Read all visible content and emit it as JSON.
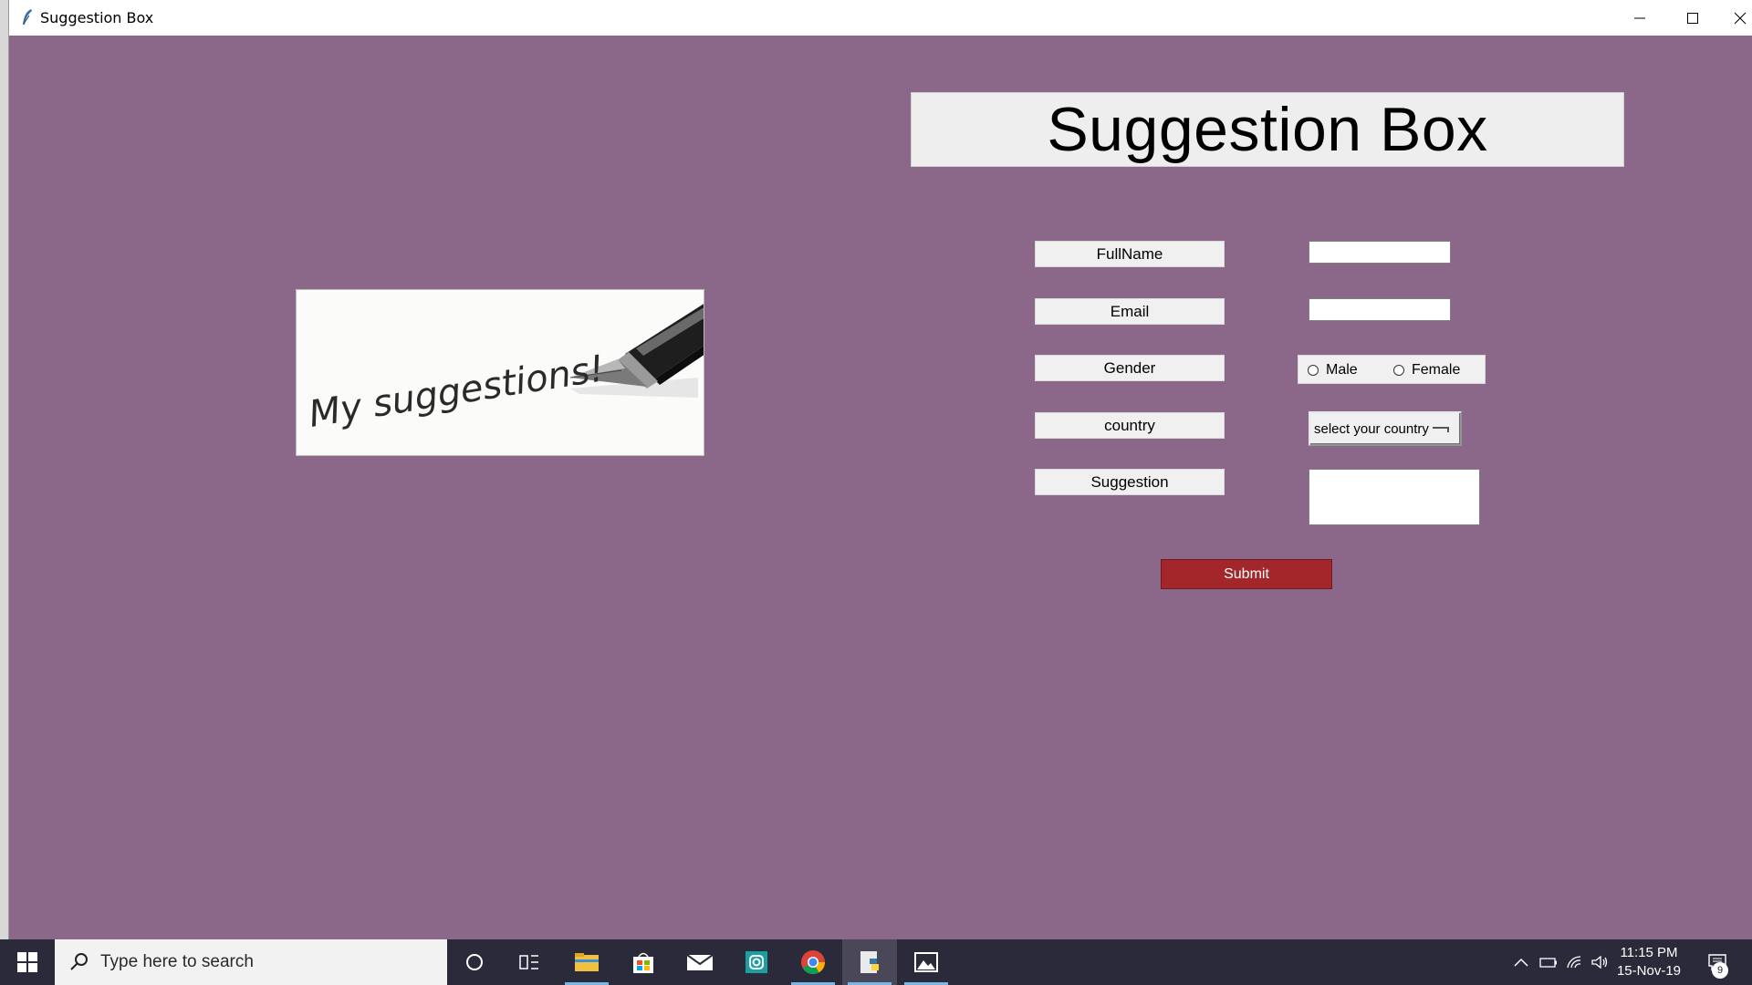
{
  "window": {
    "title": "Suggestion Box"
  },
  "header": {
    "title": "Suggestion Box"
  },
  "hero_image": {
    "text": "My suggestions!"
  },
  "form": {
    "fields": [
      {
        "label": "FullName",
        "value": ""
      },
      {
        "label": "Email",
        "value": ""
      },
      {
        "label": "Gender"
      },
      {
        "label": "country"
      },
      {
        "label": "Suggestion",
        "value": ""
      }
    ],
    "gender_options": [
      "Male",
      "Female"
    ],
    "country_select": "select your country",
    "submit_label": "Submit"
  },
  "taskbar": {
    "search_placeholder": "Type here to search",
    "time": "11:15 PM",
    "date": "15-Nov-19",
    "notification_count": "9",
    "apps": [
      "cortana-icon",
      "task-view-icon",
      "file-explorer-icon",
      "store-icon",
      "mail-icon",
      "instagram-icon",
      "chrome-icon",
      "python-editor-icon",
      "photos-icon"
    ]
  },
  "colors": {
    "background": "#8b6789",
    "submit": "#a2262a",
    "taskbar": "#2b2a3b"
  }
}
